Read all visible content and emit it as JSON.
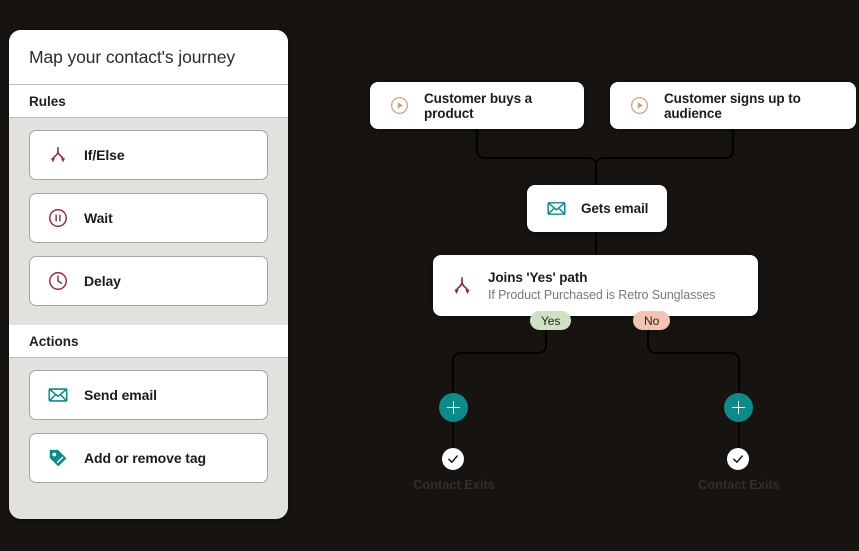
{
  "sidebar": {
    "title": "Map your contact's journey",
    "sections": [
      {
        "header": "Rules",
        "items": [
          {
            "label": "If/Else",
            "icon": "branch-icon"
          },
          {
            "label": "Wait",
            "icon": "pause-circle-icon"
          },
          {
            "label": "Delay",
            "icon": "clock-icon"
          }
        ]
      },
      {
        "header": "Actions",
        "items": [
          {
            "label": "Send email",
            "icon": "envelope-icon"
          },
          {
            "label": "Add or remove tag",
            "icon": "tag-icon"
          }
        ]
      }
    ]
  },
  "flow": {
    "triggers": [
      {
        "label": "Customer buys a product",
        "icon": "play-circle-icon"
      },
      {
        "label": "Customer signs up to audience",
        "icon": "play-circle-icon"
      }
    ],
    "email_node": {
      "label": "Gets email",
      "icon": "envelope-icon"
    },
    "condition_node": {
      "title": "Joins 'Yes' path",
      "subtitle": "If Product Purchased is Retro Sunglasses",
      "icon": "branch-icon"
    },
    "branches": [
      {
        "badge": "Yes",
        "exit_label": "Contact Exits",
        "add_label": "+"
      },
      {
        "badge": "No",
        "exit_label": "Contact Exits",
        "add_label": "+"
      }
    ]
  },
  "colors": {
    "background": "#161310",
    "panel": "#e3e1dd",
    "accent_teal": "#0f8a8a",
    "accent_maroon": "#8d2e46",
    "accent_tan": "#c9a87c",
    "badge_yes": "#cfe0c3",
    "badge_no": "#f3c4b3"
  }
}
